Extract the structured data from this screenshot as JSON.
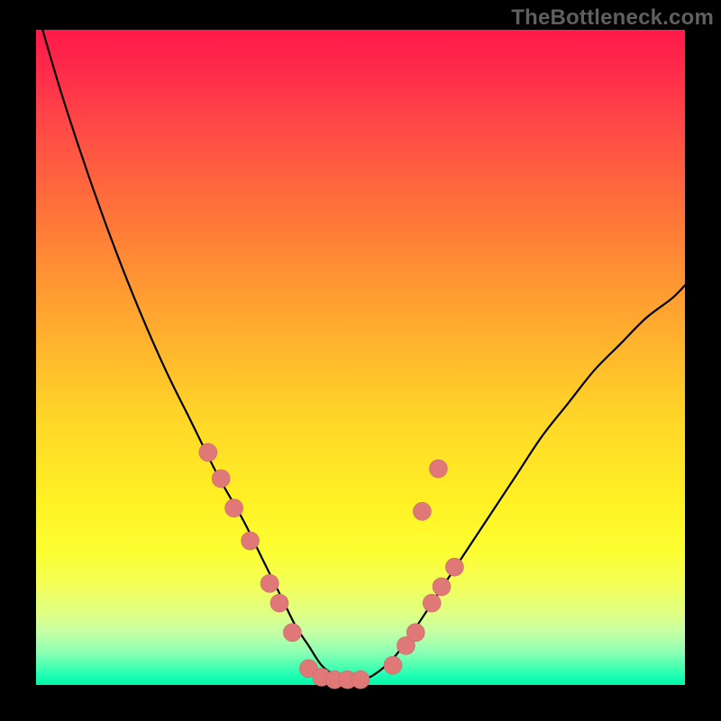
{
  "watermark": "TheBottleneck.com",
  "chart_data": {
    "type": "line",
    "title": "",
    "xlabel": "",
    "ylabel": "",
    "xlim": [
      0,
      100
    ],
    "ylim": [
      0,
      100
    ],
    "grid": false,
    "legend": false,
    "series": [
      {
        "name": "bottleneck-curve",
        "x": [
          1,
          4,
          8,
          12,
          16,
          20,
          24,
          28,
          32,
          35,
          38,
          40,
          42,
          44,
          46,
          48,
          50,
          52,
          55,
          58,
          62,
          66,
          70,
          74,
          78,
          82,
          86,
          90,
          94,
          98,
          100
        ],
        "y": [
          100,
          90,
          78,
          67,
          57,
          48,
          40,
          32,
          25,
          19,
          13,
          9,
          6,
          3,
          1.5,
          0.8,
          0.8,
          1.5,
          4,
          8,
          14,
          20,
          26,
          32,
          38,
          43,
          48,
          52,
          56,
          59,
          61
        ]
      }
    ],
    "markers": [
      {
        "x": 26.5,
        "y": 35.5
      },
      {
        "x": 28.5,
        "y": 31.5
      },
      {
        "x": 30.5,
        "y": 27.0
      },
      {
        "x": 33.0,
        "y": 22.0
      },
      {
        "x": 36.0,
        "y": 15.5
      },
      {
        "x": 37.5,
        "y": 12.5
      },
      {
        "x": 39.5,
        "y": 8.0
      },
      {
        "x": 42.0,
        "y": 2.5
      },
      {
        "x": 44.0,
        "y": 1.2
      },
      {
        "x": 46.0,
        "y": 0.8
      },
      {
        "x": 48.0,
        "y": 0.8
      },
      {
        "x": 50.0,
        "y": 0.8
      },
      {
        "x": 55.0,
        "y": 3.0
      },
      {
        "x": 57.0,
        "y": 6.0
      },
      {
        "x": 58.5,
        "y": 8.0
      },
      {
        "x": 61.0,
        "y": 12.5
      },
      {
        "x": 62.5,
        "y": 15.0
      },
      {
        "x": 64.5,
        "y": 18.0
      },
      {
        "x": 59.5,
        "y": 26.5
      },
      {
        "x": 62.0,
        "y": 33.0
      }
    ],
    "marker_radius_px": 10
  },
  "colors": {
    "curve": "#000000",
    "marker_fill": "#e07878",
    "marker_stroke": "#c96a6a",
    "frame": "#000000"
  }
}
